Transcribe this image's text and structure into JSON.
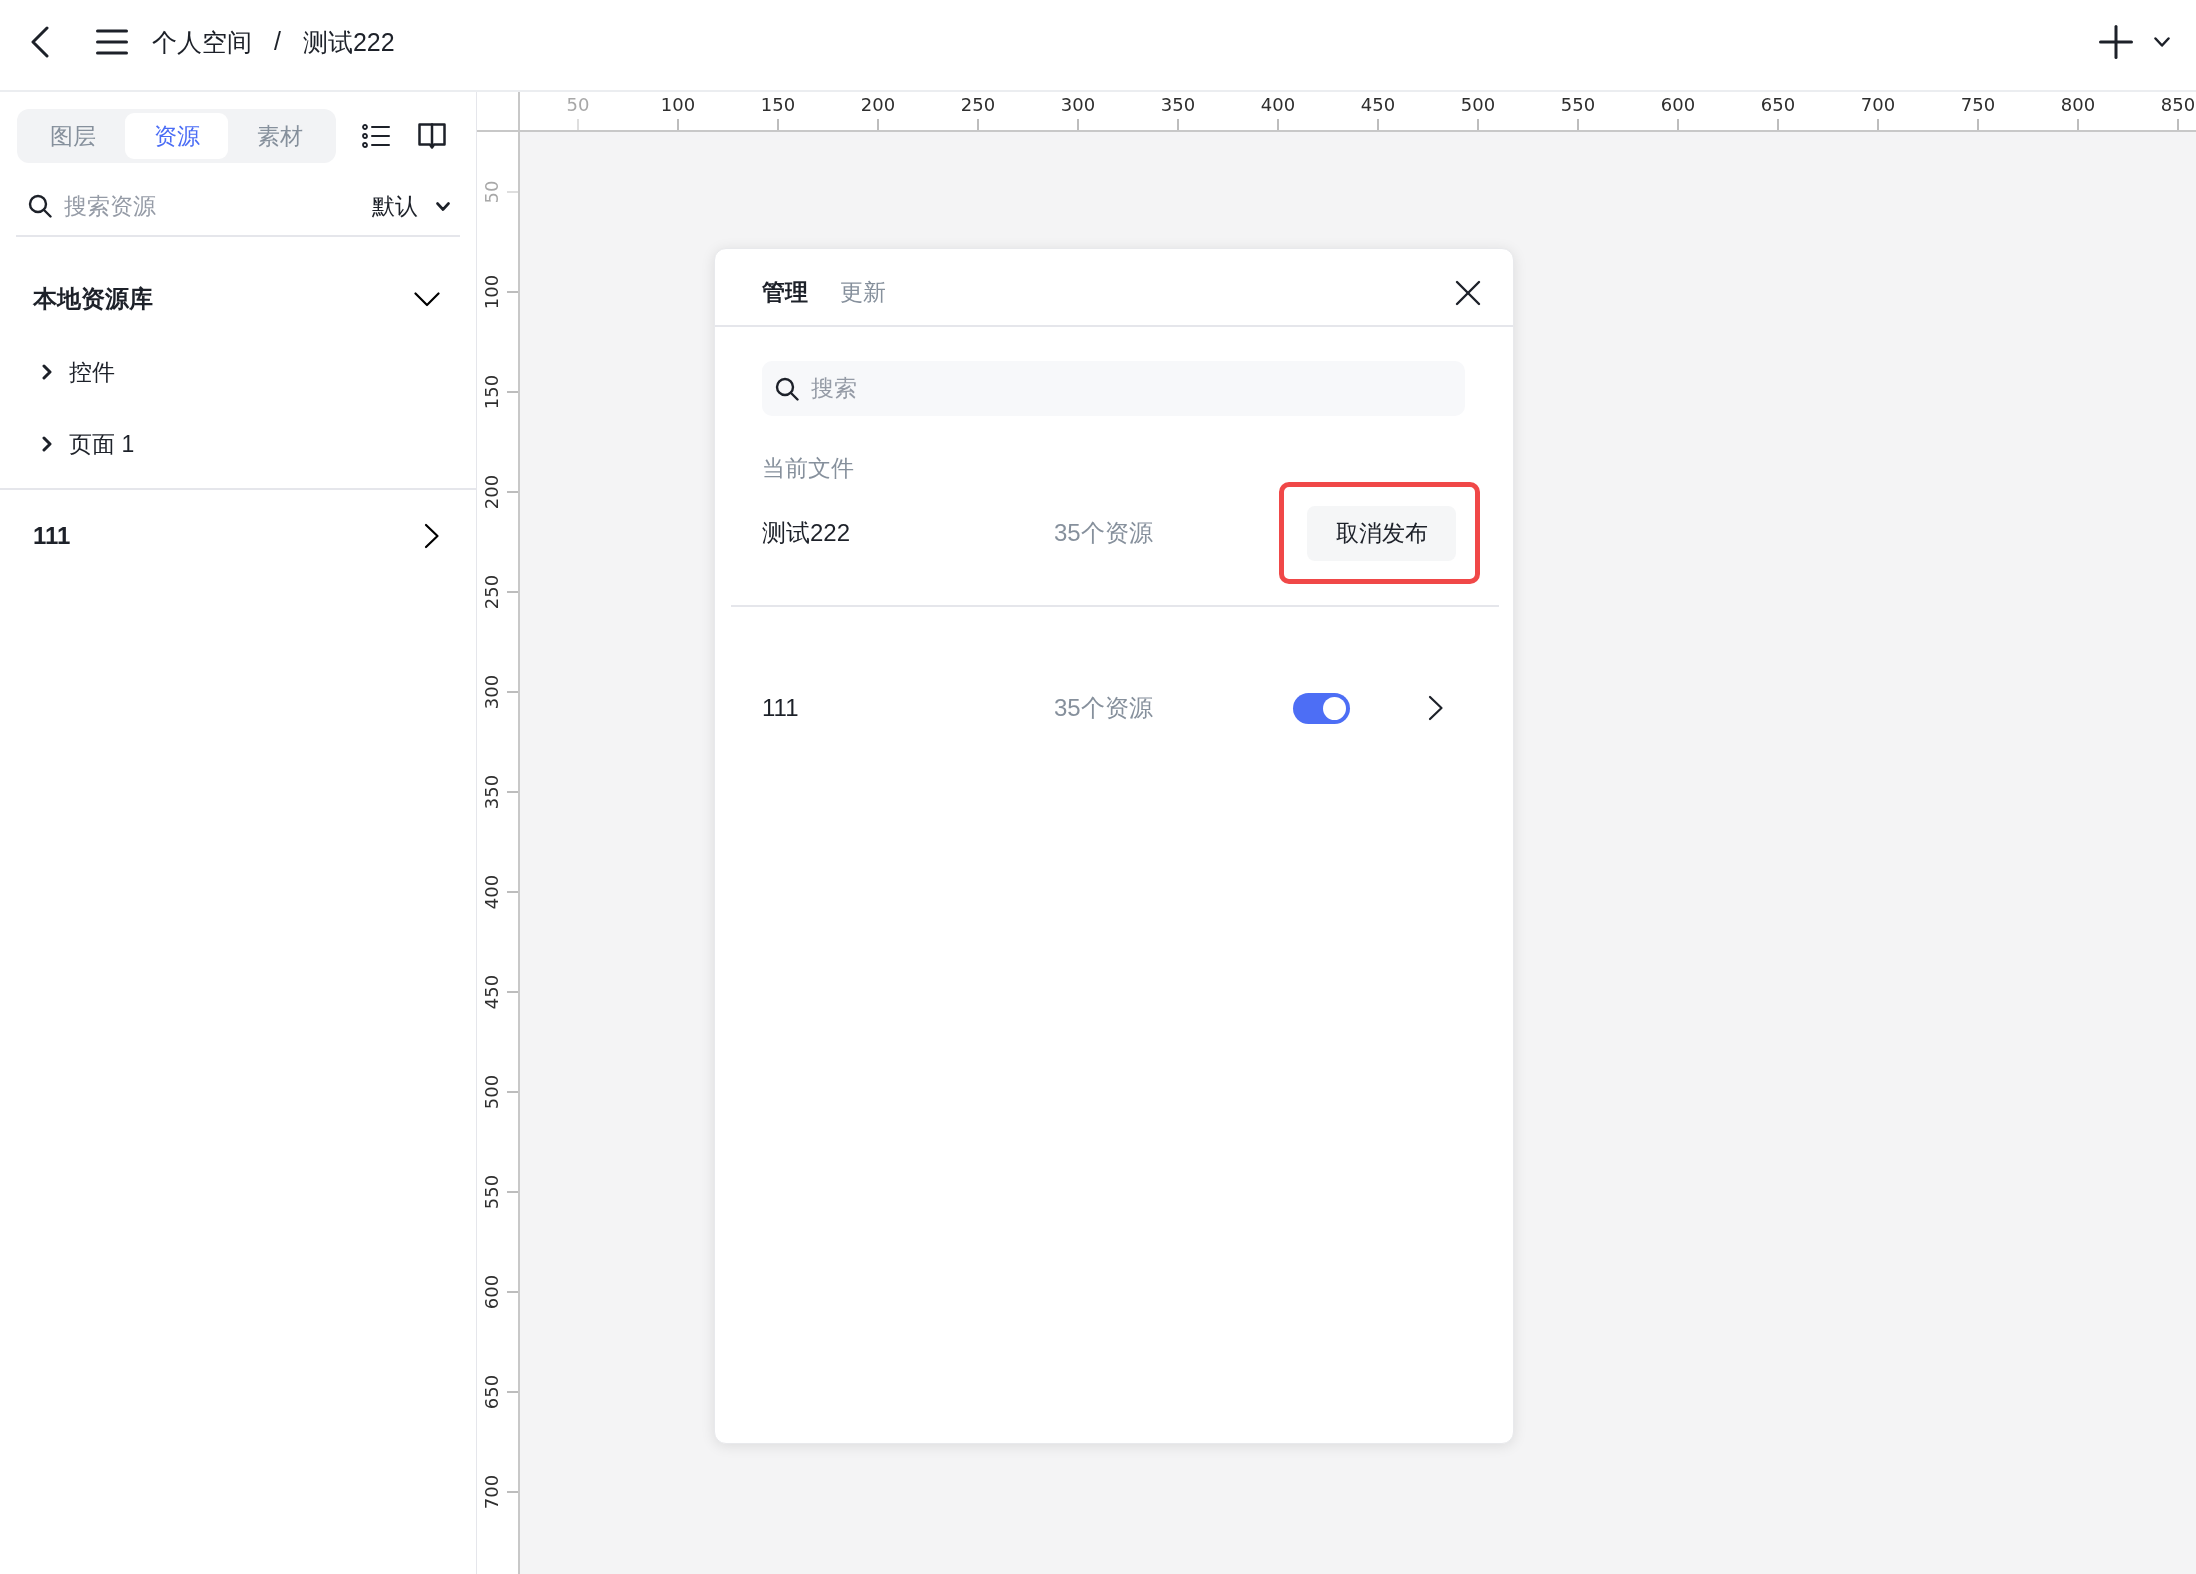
{
  "topbar": {
    "breadcrumb": [
      "个人空间",
      "测试222"
    ],
    "separator": "/"
  },
  "sidebar": {
    "tabs": [
      {
        "label": "图层",
        "selected": false
      },
      {
        "label": "资源",
        "selected": true
      },
      {
        "label": "素材",
        "selected": false
      }
    ],
    "search": {
      "placeholder": "搜索资源"
    },
    "sort": "默认",
    "libraries": [
      {
        "title": "本地资源库",
        "expanded": true,
        "children": [
          {
            "label": "控件",
            "expanded": false
          },
          {
            "label": "页面 1",
            "expanded": false
          }
        ]
      },
      {
        "title": "111",
        "expanded": false
      }
    ]
  },
  "rulers": {
    "top": [
      {
        "label": "50",
        "dimmed": true
      },
      {
        "label": "100",
        "dimmed": false
      },
      {
        "label": "150",
        "dimmed": false
      },
      {
        "label": "200",
        "dimmed": false
      },
      {
        "label": "250",
        "dimmed": false
      },
      {
        "label": "300",
        "dimmed": false
      },
      {
        "label": "350",
        "dimmed": false
      },
      {
        "label": "400",
        "dimmed": false
      },
      {
        "label": "450",
        "dimmed": false
      },
      {
        "label": "500",
        "dimmed": false
      },
      {
        "label": "550",
        "dimmed": false
      },
      {
        "label": "600",
        "dimmed": false
      },
      {
        "label": "650",
        "dimmed": false
      },
      {
        "label": "700",
        "dimmed": false
      },
      {
        "label": "750",
        "dimmed": false
      },
      {
        "label": "800",
        "dimmed": false
      },
      {
        "label": "850",
        "dimmed": false
      }
    ],
    "left": [
      {
        "label": "50",
        "dimmed": true
      },
      {
        "label": "100",
        "dimmed": false
      },
      {
        "label": "150",
        "dimmed": false
      },
      {
        "label": "200",
        "dimmed": false
      },
      {
        "label": "250",
        "dimmed": false
      },
      {
        "label": "300",
        "dimmed": false
      },
      {
        "label": "350",
        "dimmed": false
      },
      {
        "label": "400",
        "dimmed": false
      },
      {
        "label": "450",
        "dimmed": false
      },
      {
        "label": "500",
        "dimmed": false
      },
      {
        "label": "550",
        "dimmed": false
      },
      {
        "label": "600",
        "dimmed": false
      },
      {
        "label": "650",
        "dimmed": false
      },
      {
        "label": "700",
        "dimmed": false
      }
    ]
  },
  "dialog": {
    "tabs": [
      {
        "label": "管理",
        "selected": true
      },
      {
        "label": "更新",
        "selected": false
      }
    ],
    "search": {
      "placeholder": "搜索"
    },
    "current_file": {
      "heading": "当前文件",
      "name": "测试222",
      "count": "35个资源",
      "button": {
        "label": "取消发布",
        "highlighted": true
      }
    },
    "libraries": [
      {
        "name": "111",
        "count": "35个资源",
        "on": true
      }
    ]
  }
}
